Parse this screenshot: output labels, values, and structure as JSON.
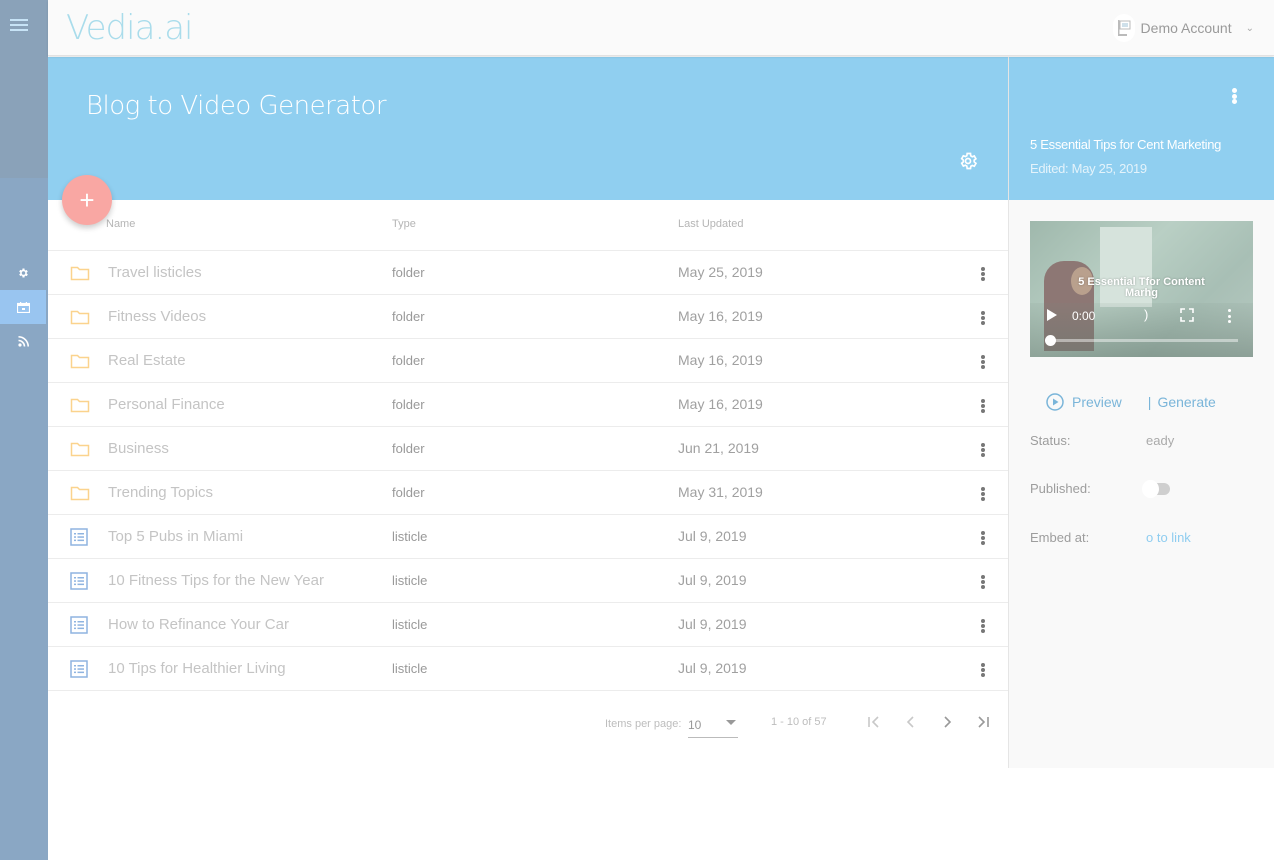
{
  "app": {
    "logo": "Vedia.ai"
  },
  "account": {
    "name": "Demo Account"
  },
  "sidebar": {
    "items": [
      {
        "name": "settings",
        "icon": "gear-icon",
        "active": false
      },
      {
        "name": "videos",
        "icon": "video-calendar-icon",
        "active": true
      },
      {
        "name": "feeds",
        "icon": "rss-icon",
        "active": false
      }
    ]
  },
  "page": {
    "title": "Blog to Video Generator"
  },
  "table": {
    "headers": {
      "name": "Name",
      "type": "Type",
      "updated": "Last Updated"
    },
    "rows": [
      {
        "name": "Travel listicles",
        "type": "folder",
        "updated": "May 25, 2019",
        "icon": "folder-icon"
      },
      {
        "name": "Fitness Videos",
        "type": "folder",
        "updated": "May 16, 2019",
        "icon": "folder-icon"
      },
      {
        "name": "Real Estate",
        "type": "folder",
        "updated": "May 16, 2019",
        "icon": "folder-icon"
      },
      {
        "name": "Personal Finance",
        "type": "folder",
        "updated": "May 16, 2019",
        "icon": "folder-icon"
      },
      {
        "name": "Business",
        "type": "folder",
        "updated": "Jun 21, 2019",
        "icon": "folder-icon"
      },
      {
        "name": "Trending Topics",
        "type": "folder",
        "updated": "May 31, 2019",
        "icon": "folder-icon"
      },
      {
        "name": "Top 5 Pubs in Miami",
        "type": "listicle",
        "updated": "Jul 9, 2019",
        "icon": "list-icon"
      },
      {
        "name": "10 Fitness Tips for the New Year",
        "type": "listicle",
        "updated": "Jul 9, 2019",
        "icon": "list-icon"
      },
      {
        "name": "How to Refinance Your Car",
        "type": "listicle",
        "updated": "Jul 9, 2019",
        "icon": "list-icon"
      },
      {
        "name": "10 Tips for Healthier Living",
        "type": "listicle",
        "updated": "Jul 9, 2019",
        "icon": "list-icon"
      }
    ]
  },
  "paginator": {
    "items_per_page_label": "Items per page:",
    "items_per_page": "10",
    "range": "1 - 10 of 57",
    "first": "|<",
    "prev": "<",
    "next": ">",
    "last": ">|"
  },
  "panel": {
    "title": "5 Essential Tips for Cent Marketing",
    "edited": "Edited: May 25, 2019",
    "video": {
      "caption_line1": "5 Essential Tfor Content",
      "caption_line2": "Marhg",
      "time": "0:00",
      "progress": 0
    },
    "preview_label": "Preview",
    "generate_label": "Generate",
    "status_label": "Status:",
    "status_value": "eady",
    "published_label": "Published:",
    "published": false,
    "embed_label": "Embed at:",
    "embed_value": "o to link"
  },
  "colors": {
    "banner": "#90cff0",
    "sidebar": "#8aa7c4",
    "fab": "#f9a7a3",
    "folder": "#fbd38d",
    "list": "#8fb4e0",
    "link": "#7ab5d9"
  }
}
